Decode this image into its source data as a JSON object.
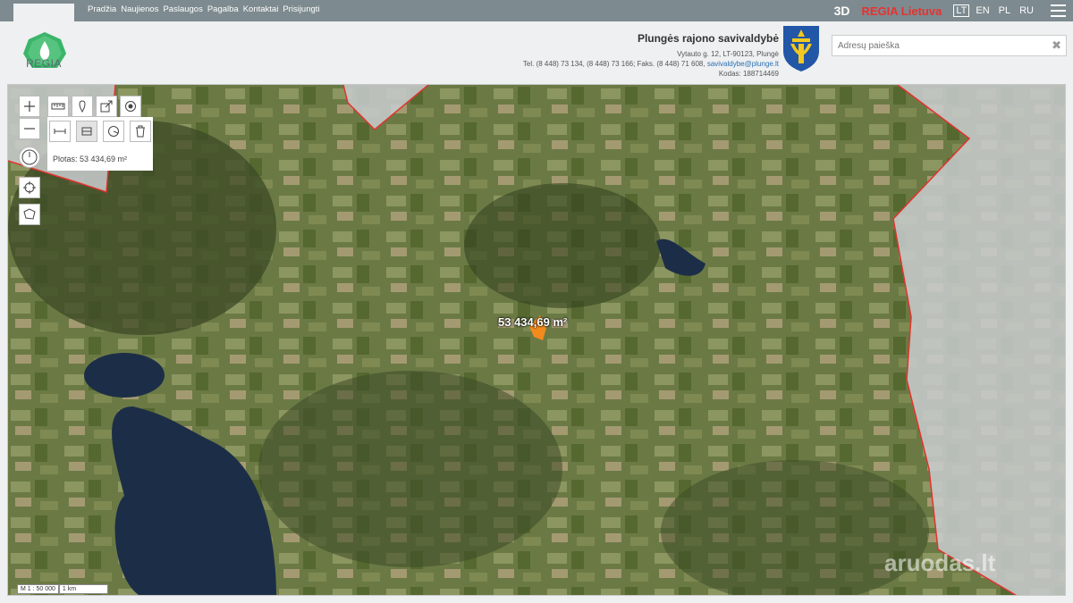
{
  "nav": {
    "items": [
      "Pradžia",
      "Naujienos",
      "Paslaugos",
      "Pagalba",
      "Kontaktai",
      "Prisijungti"
    ]
  },
  "topright": {
    "mode_3d": "3D",
    "brand": "REGIA Lietuva",
    "languages": [
      "LT",
      "EN",
      "PL",
      "RU"
    ],
    "active_language": "LT"
  },
  "logo": {
    "text": "REGIA"
  },
  "municipality": {
    "name": "Plungės rajono savivaldybė",
    "address": "Vytauto g. 12, LT-90123, Plungė",
    "phone": "Tel. (8 448) 73 134, (8 448) 73 166; Faks. (8 448) 71 608,",
    "email": "savivaldybe@plunge.lt",
    "code": "Kodas: 188714469"
  },
  "search": {
    "placeholder": "Adresų paieška",
    "value": ""
  },
  "map": {
    "area_readout": "Plotas: 53 434,69 m²",
    "area_label": "53 434,69 m²",
    "scale_ratio": "M 1 : 50 000",
    "scale_bar": "1 km",
    "watermark": "aruodas.lt",
    "colors": {
      "boundary": "#e0342e",
      "parcel": "#f28a1c",
      "lake": "#1c2e47"
    }
  },
  "icons": {
    "zoom_in": "plus-icon",
    "zoom_out": "minus-icon",
    "measure": "ruler-icon",
    "marker": "map-pin-icon",
    "share": "share-icon",
    "record": "target-icon",
    "compass": "compass-icon",
    "locate": "crosshair-icon",
    "draw": "polygon-icon"
  }
}
